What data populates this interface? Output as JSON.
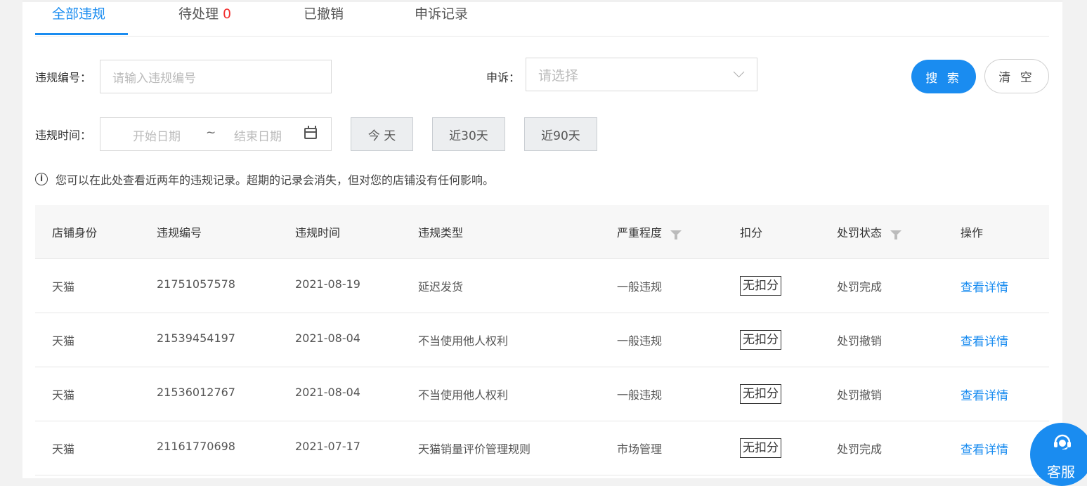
{
  "tabs": [
    {
      "label": "全部违规",
      "count": ""
    },
    {
      "label": "待处理",
      "count": "0"
    },
    {
      "label": "已撤销",
      "count": ""
    },
    {
      "label": "申诉记录",
      "count": ""
    }
  ],
  "filters": {
    "violation_id_label": "违规编号：",
    "violation_id_placeholder": "请输入违规编号",
    "appeal_label": "申诉：",
    "appeal_placeholder": "请选择",
    "time_label": "违规时间：",
    "start_placeholder": "开始日期",
    "range_sep": "~",
    "end_placeholder": "结束日期",
    "quick_today": "今 天",
    "quick_30": "近30天",
    "quick_90": "近90天",
    "search_button": "搜 索",
    "clear_button": "清 空"
  },
  "info_text": "您可以在此处查看近两年的违规记录。超期的记录会消失，但对您的店铺没有任何影响。",
  "table": {
    "headers": {
      "shop": "店铺身份",
      "id": "违规编号",
      "time": "违规时间",
      "type": "违规类型",
      "severity": "严重程度",
      "points": "扣分",
      "status": "处罚状态",
      "action": "操作"
    },
    "rows": [
      {
        "shop": "天猫",
        "id": "21751057578",
        "time": "2021-08-19",
        "type": "延迟发货",
        "severity": "一般违规",
        "points": "无扣分",
        "status": "处罚完成",
        "action": "查看详情"
      },
      {
        "shop": "天猫",
        "id": "21539454197",
        "time": "2021-08-04",
        "type": "不当使用他人权利",
        "severity": "一般违规",
        "points": "无扣分",
        "status": "处罚撤销",
        "action": "查看详情"
      },
      {
        "shop": "天猫",
        "id": "21536012767",
        "time": "2021-08-04",
        "type": "不当使用他人权利",
        "severity": "一般违规",
        "points": "无扣分",
        "status": "处罚撤销",
        "action": "查看详情"
      },
      {
        "shop": "天猫",
        "id": "21161770698",
        "time": "2021-07-17",
        "type": "天猫销量评价管理规则",
        "severity": "市场管理",
        "points": "无扣分",
        "status": "处罚完成",
        "action": "查看详情"
      }
    ]
  },
  "support": {
    "label": "客服",
    "icon": "headset-icon"
  },
  "colors": {
    "accent": "#1a8cf0",
    "count_red": "#f23030"
  }
}
